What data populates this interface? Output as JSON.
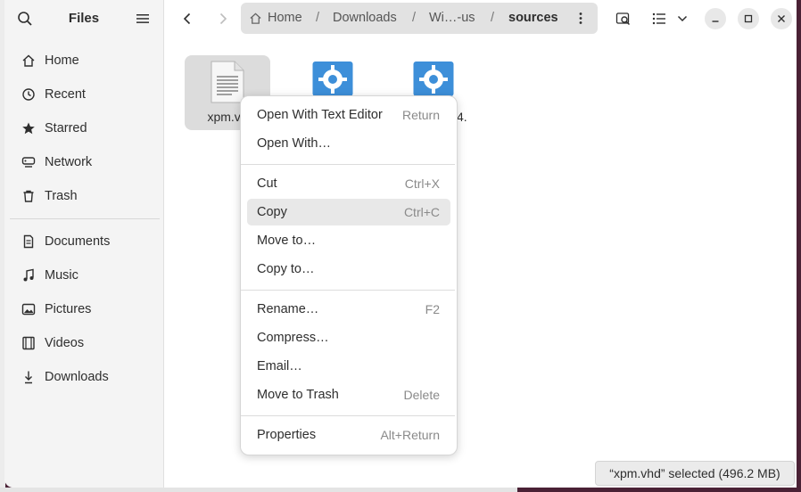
{
  "sidebar": {
    "title": "Files",
    "places": [
      {
        "label": "Home",
        "icon": "home-icon"
      },
      {
        "label": "Recent",
        "icon": "clock-icon"
      },
      {
        "label": "Starred",
        "icon": "star-icon"
      },
      {
        "label": "Network",
        "icon": "network-icon"
      },
      {
        "label": "Trash",
        "icon": "trash-icon"
      }
    ],
    "bookmarks": [
      {
        "label": "Documents",
        "icon": "document-icon"
      },
      {
        "label": "Music",
        "icon": "music-icon"
      },
      {
        "label": "Pictures",
        "icon": "picture-icon"
      },
      {
        "label": "Videos",
        "icon": "video-icon"
      },
      {
        "label": "Downloads",
        "icon": "download-icon"
      }
    ]
  },
  "path": [
    "Home",
    "Downloads",
    "Wi…-us",
    "sources"
  ],
  "path_separator": "/",
  "files": [
    {
      "name": "xpm.vhd",
      "visible_name": "xpm.vh",
      "icon": "text-file-icon"
    },
    {
      "name": "",
      "icon": "settings-file-icon"
    },
    {
      "name": "",
      "visible_name": "4.",
      "icon": "settings-file-icon"
    }
  ],
  "context_menu": [
    {
      "label": "Open With Text Editor",
      "shortcut": "Return"
    },
    {
      "label": "Open With…",
      "shortcut": ""
    },
    {
      "label": "Cut",
      "shortcut": "Ctrl+X"
    },
    {
      "label": "Copy",
      "shortcut": "Ctrl+C"
    },
    {
      "label": "Move to…",
      "shortcut": ""
    },
    {
      "label": "Copy to…",
      "shortcut": ""
    },
    {
      "label": "Rename…",
      "shortcut": "F2"
    },
    {
      "label": "Compress…",
      "shortcut": ""
    },
    {
      "label": "Email…",
      "shortcut": ""
    },
    {
      "label": "Move to Trash",
      "shortcut": "Delete"
    },
    {
      "label": "Properties",
      "shortcut": "Alt+Return"
    }
  ],
  "status": "“xpm.vhd” selected  (496.2 MB)",
  "colors": {
    "folder_icon_blue": "#3d8fd9",
    "desktop_bg": "#4a2135",
    "selection": "#dcdcdc"
  }
}
